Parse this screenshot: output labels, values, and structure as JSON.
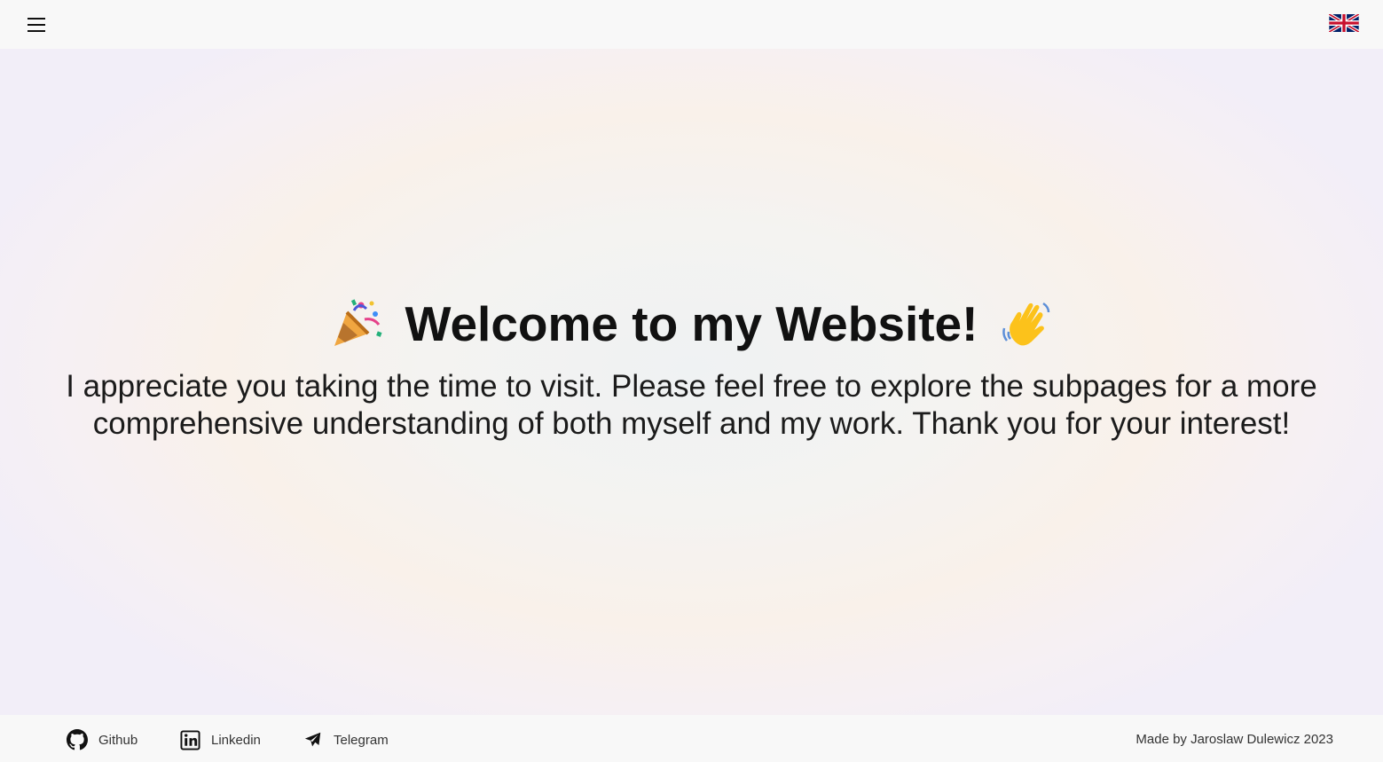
{
  "header": {
    "menu_icon": "hamburger-menu-icon",
    "language_flag": "uk-flag-icon"
  },
  "hero": {
    "title": "Welcome to my Website!",
    "left_emoji": "party-popper-icon",
    "right_emoji": "waving-hand-icon",
    "text": "I appreciate you taking the time to visit. Please feel free to explore the subpages for a more comprehensive understanding of both myself and my work. Thank you for your interest!"
  },
  "footer": {
    "links": [
      {
        "label": "Github",
        "icon": "github-icon"
      },
      {
        "label": "Linkedin",
        "icon": "linkedin-icon"
      },
      {
        "label": "Telegram",
        "icon": "telegram-icon"
      }
    ],
    "credit": "Made by Jaroslaw Dulewicz 2023"
  },
  "colors": {
    "text": "#111111",
    "bar_background": "#f8f8f8"
  }
}
